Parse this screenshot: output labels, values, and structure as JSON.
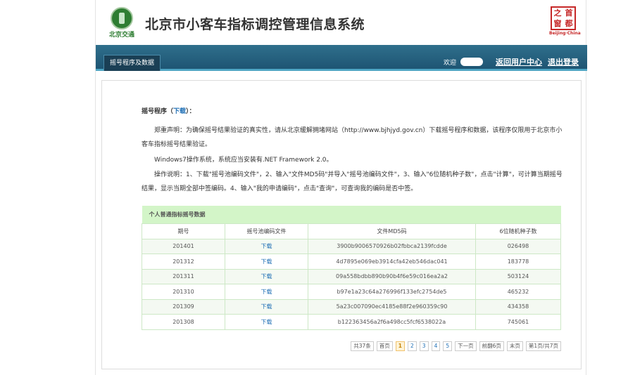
{
  "header": {
    "logo_text": "北京交通",
    "title": "北京市小客车指标调控管理信息系统",
    "seal_chars": [
      "之",
      "首",
      "窗",
      "都"
    ],
    "seal_caption": "Beijing·China"
  },
  "nav": {
    "tab_label": "摇号程序及数据",
    "welcome": "欢迎",
    "user_center": "返回用户中心",
    "logout": "退出登录"
  },
  "section": {
    "title_prefix": "摇号程序（",
    "title_link": "下载",
    "title_suffix": "）：",
    "para1": "郑重声明：为确保摇号结果验证的真实性，请从北京缓解拥堵网站（http://www.bjhjyd.gov.cn）下载摇号程序和数据，该程序仅限用于北京市小客车指标摇号结果验证。",
    "para2": "Windows7操作系统，系统应当安装有.NET Framework 2.0。",
    "para3": "操作说明：1、下载\"摇号池编码文件\"，2、输入\"文件MD5码\"并导入\"摇号池编码文件\"，3、输入\"6位随机种子数\"，点击\"计算\"，可计算当期摇号结果，显示当期全部中签编码。4、输入\"我的申请编码\"，点击\"查询\"，可查询我的编码是否中签。"
  },
  "table": {
    "caption": "个人普通指标摇号数据",
    "headers": [
      "期号",
      "摇号池编码文件",
      "文件MD5码",
      "6位随机种子数"
    ],
    "rows": [
      [
        "201401",
        "下载",
        "3900b9006570926b02fbbca2139fcdde",
        "026498"
      ],
      [
        "201312",
        "下载",
        "4d7895e069eb3914cfa42eb546dac041",
        "183778"
      ],
      [
        "201311",
        "下载",
        "09a558bdbb890b90b4f6e59c016ea2a2",
        "503124"
      ],
      [
        "201310",
        "下载",
        "b97e1a23c64a276996f133efc2754de5",
        "465232"
      ],
      [
        "201309",
        "下载",
        "5a23c007090ec4185e88f2e960359c90",
        "434358"
      ],
      [
        "201308",
        "下载",
        "b122363456a2f6a498cc5fcf6538022a",
        "745061"
      ]
    ]
  },
  "pager": {
    "total": "共37条",
    "first": "首页",
    "pages": [
      "1",
      "2",
      "3",
      "4",
      "5"
    ],
    "current": "1",
    "next": "下一页",
    "jump": "前翻6页",
    "last": "末页",
    "status": "第1页/共7页"
  },
  "colors": {
    "nav_bg": "#1e5573",
    "table_caption_bg": "#d3f5c8",
    "link": "#1f6fb5"
  }
}
